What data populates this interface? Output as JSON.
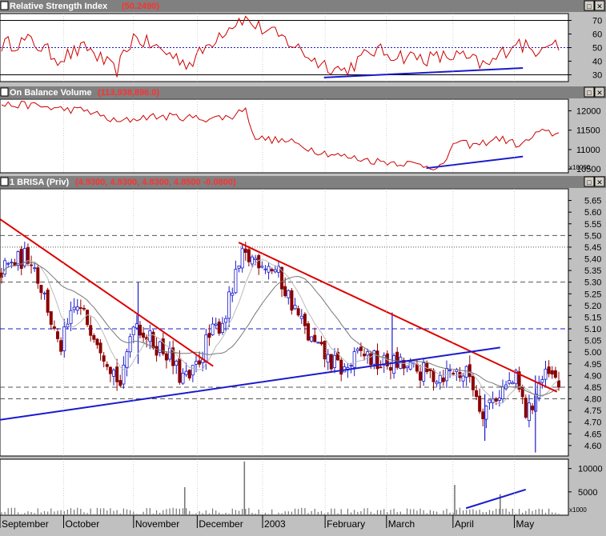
{
  "window": {
    "panes": [
      {
        "label": "Relative Strength Index",
        "value": "(50.2490)"
      },
      {
        "label": "On Balance Volume",
        "value": "(113,938,896.0)"
      },
      {
        "label": "1 BRISA (Priv)",
        "value": "(4.9300, 4.9300, 4.8300, 4.8500 -0.0800)"
      }
    ],
    "obv_unit": "x10000",
    "volume_unit": "x1000",
    "buttons": {
      "maximize": "□",
      "close": "✕"
    }
  },
  "colors": {
    "background": "#ffffff",
    "frame": "#c0c0c0",
    "oscillator": "#cc0000",
    "trendline_down": "#dd0000",
    "trendline_up": "#1a1acc",
    "candle_up": "#1a1acc",
    "candle_down": "#8b0000",
    "moving_average": "#999999",
    "grid": "#7f7f7f"
  },
  "chart_data": [
    {
      "type": "line",
      "title": "Relative Strength Index",
      "latest_value": 50.249,
      "y_ticks": [
        "70",
        "60",
        "50",
        "40",
        "30"
      ],
      "ylim": [
        25,
        75
      ],
      "reference_lines": [
        70,
        50,
        30
      ],
      "divergence_line": {
        "from": [
          0.57,
          28
        ],
        "to": [
          0.92,
          35
        ]
      }
    },
    {
      "type": "line",
      "title": "On Balance Volume",
      "latest_value": 113938896.0,
      "y_ticks": [
        "12000",
        "11500",
        "11000",
        "10500"
      ],
      "ylim": [
        10400,
        12300
      ],
      "divergence_line": {
        "from": [
          0.75,
          10520
        ],
        "to": [
          0.92,
          10820
        ]
      }
    },
    {
      "type": "candlestick",
      "title": "1 BRISA (Priv)",
      "last_bar": {
        "open": 4.93,
        "high": 4.93,
        "low": 4.83,
        "close": 4.85,
        "change": -0.08
      },
      "y_ticks": [
        "5.65",
        "5.60",
        "5.55",
        "5.50",
        "5.45",
        "5.40",
        "5.35",
        "5.30",
        "5.25",
        "5.20",
        "5.15",
        "5.10",
        "5.05",
        "5.00",
        "4.95",
        "4.90",
        "4.85",
        "4.80",
        "4.75",
        "4.70",
        "4.65",
        "4.60"
      ],
      "ylim": [
        4.555,
        5.7
      ],
      "horizontal_levels": [
        5.5,
        5.45,
        5.3,
        5.1,
        4.85,
        4.8
      ],
      "trendlines": [
        {
          "color": "down",
          "from": [
            0.0,
            5.57
          ],
          "to": [
            0.375,
            4.94
          ]
        },
        {
          "color": "down",
          "from": [
            0.42,
            5.47
          ],
          "to": [
            0.98,
            4.83
          ]
        },
        {
          "color": "up",
          "from": [
            0.0,
            4.71
          ],
          "to": [
            0.88,
            5.02
          ]
        }
      ]
    },
    {
      "type": "bar",
      "title": "Volume",
      "y_ticks": [
        "10000",
        "5000"
      ],
      "ylim": [
        0,
        12000
      ],
      "spikes": [
        {
          "x": 0.325,
          "value": 6000
        },
        {
          "x": 0.43,
          "value": 11500
        },
        {
          "x": 0.8,
          "value": 6500
        },
        {
          "x": 0.88,
          "value": 4500
        }
      ],
      "trend_line": {
        "from": [
          0.82,
          1500
        ],
        "to": [
          0.925,
          5500
        ]
      }
    }
  ],
  "x_axis": {
    "months": [
      {
        "label": "September",
        "x": 0.0
      },
      {
        "label": "October",
        "x": 0.112
      },
      {
        "label": "November",
        "x": 0.235
      },
      {
        "label": "December",
        "x": 0.347
      },
      {
        "label": "2003",
        "x": 0.462
      },
      {
        "label": "February",
        "x": 0.572
      },
      {
        "label": "March",
        "x": 0.68
      },
      {
        "label": "April",
        "x": 0.797
      },
      {
        "label": "May",
        "x": 0.905
      }
    ]
  }
}
